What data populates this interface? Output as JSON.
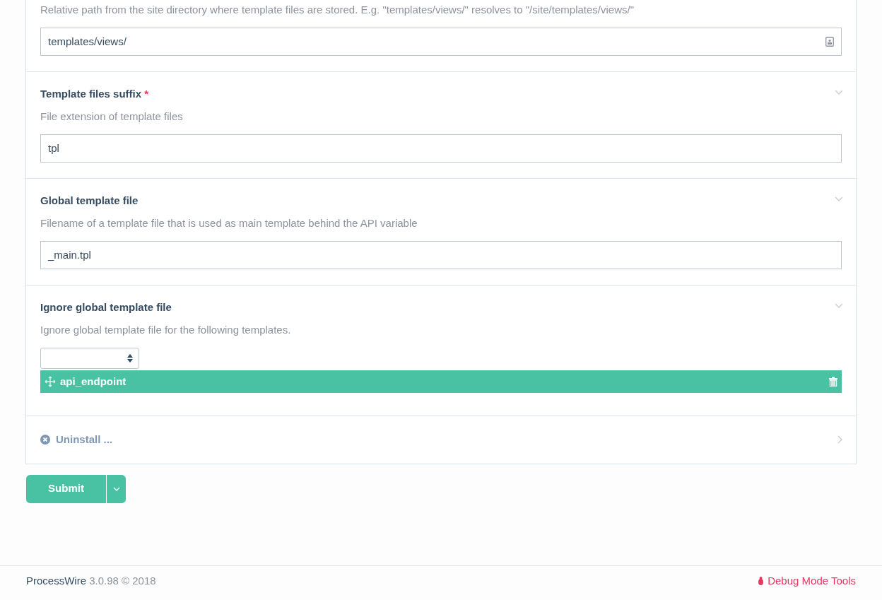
{
  "fields": [
    {
      "kind": "text",
      "description": "Relative path from the site directory where template files are stored. E.g. \"templates/views/\" resolves to \"/site/templates/views/\"",
      "value": "templates/views/"
    },
    {
      "kind": "text",
      "label": "Template files suffix",
      "required_marker": "*",
      "description": "File extension of template files",
      "value": "tpl"
    },
    {
      "kind": "text",
      "label": "Global template file",
      "description": "Filename of a template file that is used as main template behind the API variable",
      "value": "_main.tpl"
    },
    {
      "kind": "asmselect",
      "label": "Ignore global template file",
      "description": "Ignore global template file for the following templates.",
      "items": [
        {
          "label": "api_endpoint"
        }
      ]
    },
    {
      "kind": "uninstall",
      "label": "Uninstall ...",
      "collapsed": true
    }
  ],
  "submit": {
    "label": "Submit"
  },
  "footer": {
    "brand": "ProcessWire",
    "version": "3.0.98 © 2018",
    "debug": "Debug Mode Tools"
  }
}
